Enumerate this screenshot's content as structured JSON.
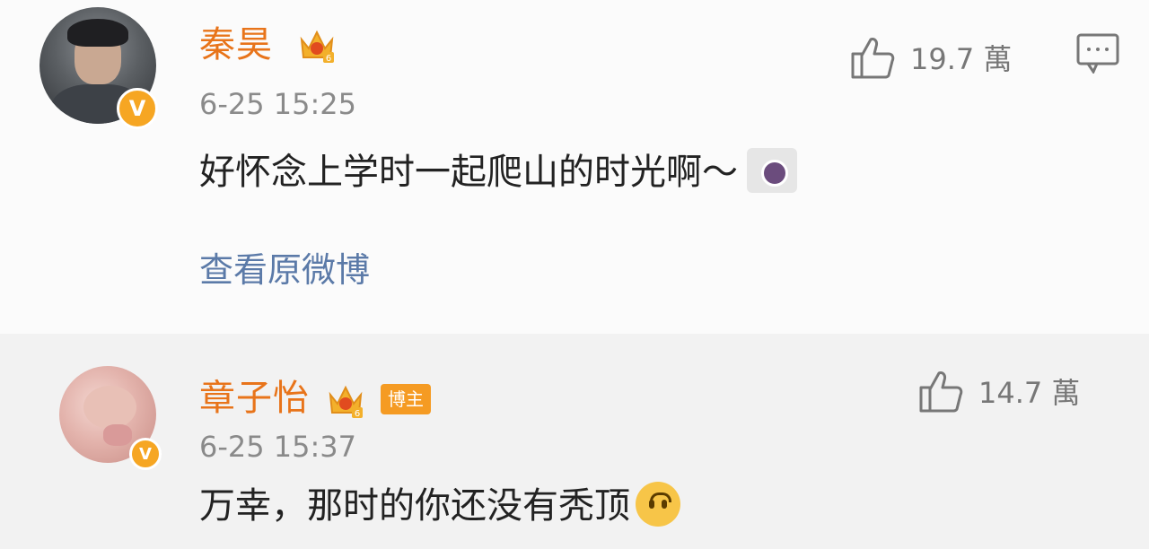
{
  "comments": [
    {
      "username": "秦昊",
      "crown_level": "6",
      "time": "6-25 15:25",
      "text": "好怀念上学时一起爬山的时光啊～",
      "emoji": "camera-icon",
      "link": "查看原微博",
      "likes": "19.7 萬",
      "verified_badge": "V"
    },
    {
      "username": "章子怡",
      "crown_level": "6",
      "tag": "博主",
      "time": "6-25 15:37",
      "text": "万幸，那时的你还没有秃顶",
      "emoji": "upside-down-face-icon",
      "likes": "14.7 萬",
      "verified_badge": "V"
    }
  ],
  "colors": {
    "name": "#e8741a",
    "link": "#5b7aa8",
    "badge": "#f6a623"
  }
}
